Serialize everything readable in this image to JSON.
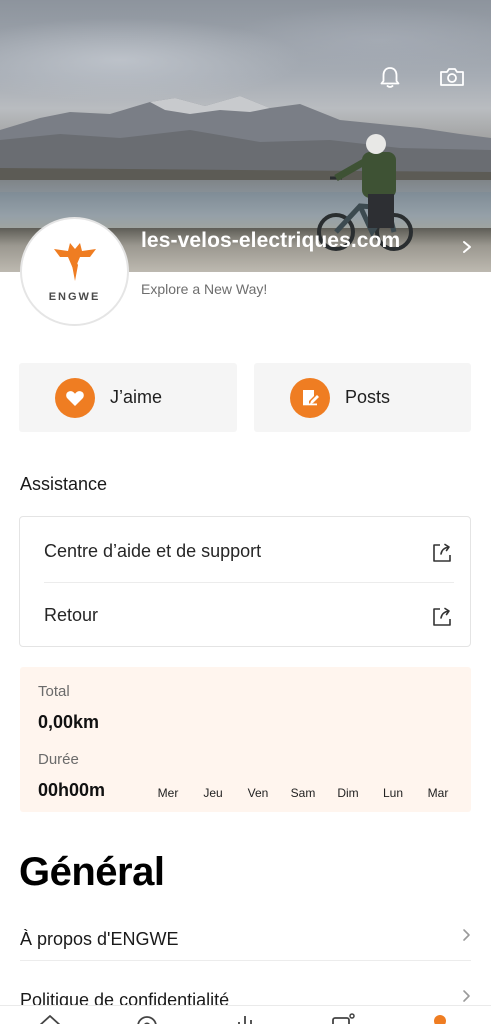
{
  "header": {
    "profile_name": "les-velos-electriques.com",
    "tagline": "Explore a New Way!",
    "avatar_brand": "ENGWE",
    "icons": [
      "bell-icon",
      "camera-icon",
      "chevron-right-icon"
    ]
  },
  "actions": {
    "like_label": "J’aime",
    "posts_label": "Posts"
  },
  "assistance": {
    "title": "Assistance",
    "items": [
      {
        "label": "Centre d’aide et de support"
      },
      {
        "label": "Retour"
      }
    ]
  },
  "stats": {
    "total_label": "Total",
    "total_value": "0,00km",
    "duration_label": "Durée",
    "duration_value": "00h00m",
    "days": [
      "Mer",
      "Jeu",
      "Ven",
      "Sam",
      "Dim",
      "Lun",
      "Mar"
    ]
  },
  "general": {
    "title": "Général",
    "items": [
      {
        "label": "À propos d'ENGWE"
      },
      {
        "label": "Politique de confidentialité"
      }
    ]
  },
  "colors": {
    "accent": "#ef7d22",
    "stats_bg": "#fff5ee",
    "card_bg": "#f5f5f5"
  },
  "tabbar": {
    "icons": [
      "home-icon",
      "ride-icon",
      "stats-icon",
      "device-icon",
      "profile-icon"
    ],
    "active_index": 4
  }
}
